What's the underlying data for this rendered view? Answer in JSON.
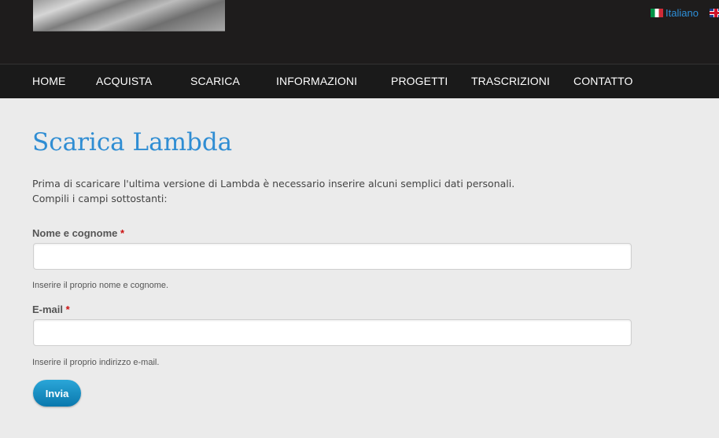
{
  "language_selector": {
    "current": "Italiano",
    "flags": [
      "italian-flag-icon",
      "uk-flag-icon"
    ]
  },
  "nav": {
    "items": [
      {
        "label": "HOME"
      },
      {
        "label": "ACQUISTA"
      },
      {
        "label": "SCARICA"
      },
      {
        "label": "INFORMAZIONI"
      },
      {
        "label": "PROGETTI"
      },
      {
        "label": "TRASCRIZIONI"
      },
      {
        "label": "CONTATTO"
      }
    ]
  },
  "main": {
    "title": "Scarica Lambda",
    "intro_line1": "Prima di scaricare l'ultima versione di Lambda è necessario inserire alcuni semplici dati personali.",
    "intro_line2": "Compili i campi sottostanti:"
  },
  "form": {
    "name_label": "Nome e cognome",
    "name_value": "",
    "name_help": "Inserire il proprio nome e cognome.",
    "email_label": "E-mail",
    "email_value": "",
    "email_help": "Inserire il proprio indirizzo e-mail.",
    "required_marker": "*",
    "submit_label": "Invia"
  },
  "colors": {
    "accent": "#2f8dd3",
    "header_bg": "#1e1c1c",
    "button": "#1a8fc4",
    "required": "#cc1111"
  }
}
